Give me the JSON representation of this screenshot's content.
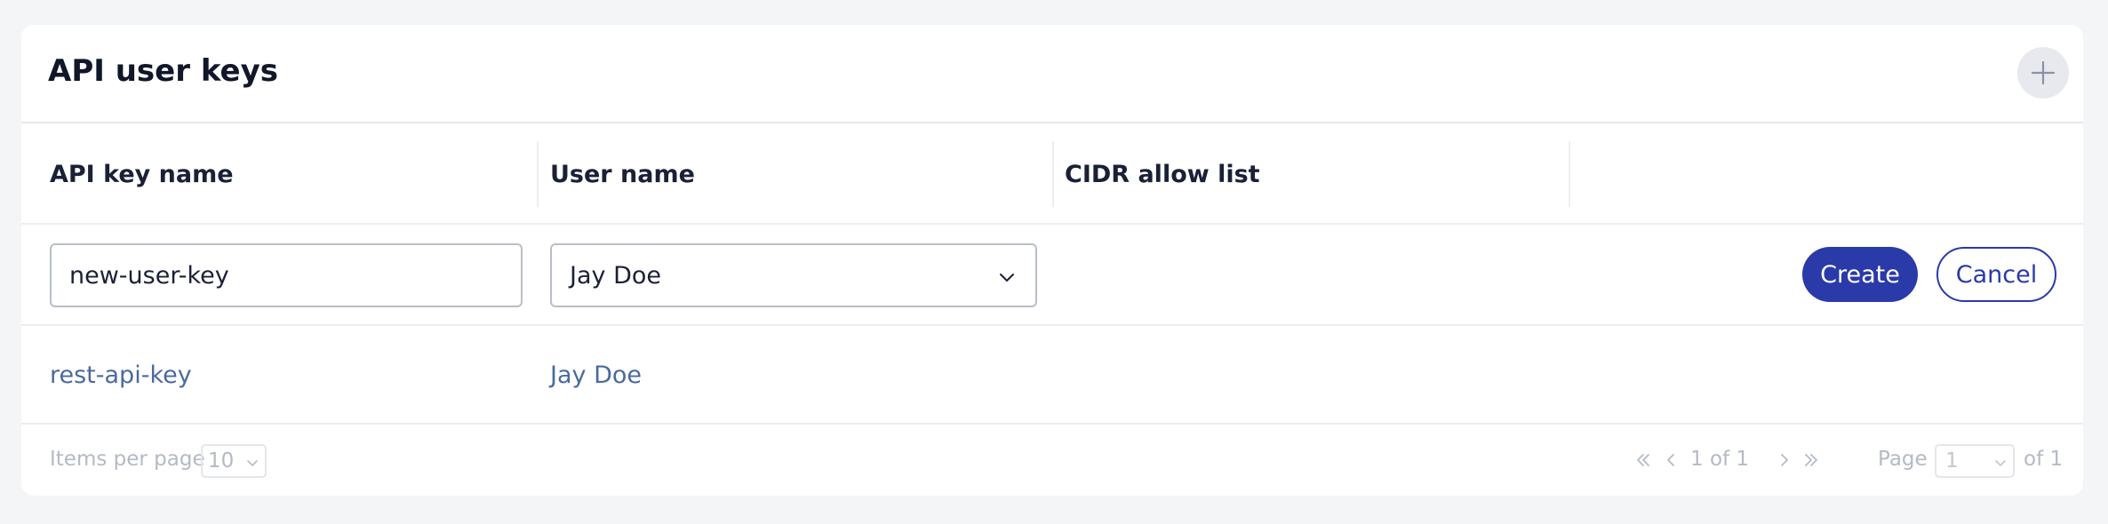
{
  "card": {
    "title": "API user keys"
  },
  "table": {
    "columns": [
      "API key name",
      "User name",
      "CIDR allow list",
      ""
    ],
    "edit_row": {
      "key_name_value": "new-user-key",
      "user_select_value": "Jay Doe",
      "create_label": "Create",
      "cancel_label": "Cancel"
    },
    "rows": [
      {
        "key_name": "rest-api-key",
        "user_name": "Jay Doe",
        "cidr": ""
      }
    ]
  },
  "footer": {
    "items_per_page_label": "Items per page",
    "items_per_page_value": "10",
    "range_text": "1 of 1",
    "page_label": "Page",
    "page_value": "1",
    "page_total": "of 1"
  },
  "colors": {
    "primary": "#2a3aa8",
    "link": "#4a6a9c",
    "muted": "#b4bac5"
  },
  "icons": {
    "add": "plus-icon",
    "select": "chevron-down-icon",
    "first": "chevrons-left-icon",
    "prev": "chevron-left-icon",
    "next": "chevron-right-icon",
    "last": "chevrons-right-icon"
  }
}
